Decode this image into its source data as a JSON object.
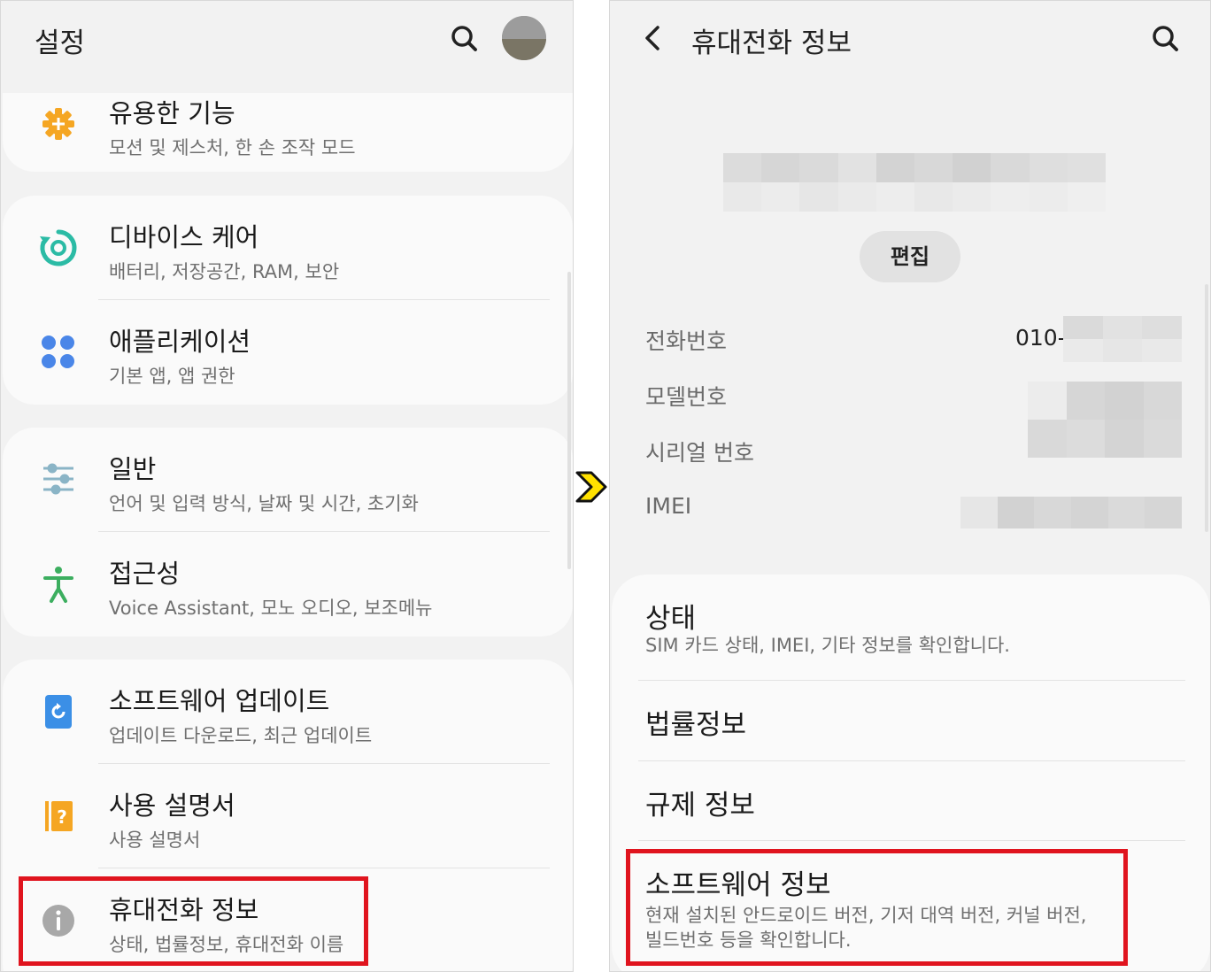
{
  "settings": {
    "title": "설정",
    "search_icon": "search-icon",
    "avatar_icon": "avatar",
    "items": [
      {
        "label": "유용한 기능",
        "sub": "모션 및 제스처, 한 손 조작 모드",
        "icon": "advanced-features-icon",
        "color": "#f5a623"
      },
      {
        "label": "디바이스 케어",
        "sub": "배터리, 저장공간, RAM, 보안",
        "icon": "device-care-icon",
        "color": "#2bbba5"
      },
      {
        "label": "애플리케이션",
        "sub": "기본 앱, 앱 권한",
        "icon": "apps-icon",
        "color": "#4a86e8"
      },
      {
        "label": "일반",
        "sub": "언어 및 입력 방식, 날짜 및 시간, 초기화",
        "icon": "general-management-icon",
        "color": "#8ab4c6"
      },
      {
        "label": "접근성",
        "sub": "Voice Assistant, 모노 오디오, 보조메뉴",
        "icon": "accessibility-icon",
        "color": "#3cae5f"
      },
      {
        "label": "소프트웨어 업데이트",
        "sub": "업데이트 다운로드, 최근 업데이트",
        "icon": "software-update-icon",
        "color": "#3b8fe6"
      },
      {
        "label": "사용 설명서",
        "sub": "사용 설명서",
        "icon": "user-manual-icon",
        "color": "#f5a623"
      },
      {
        "label": "휴대전화 정보",
        "sub": "상태, 법률정보, 휴대전화 이름",
        "icon": "info-icon",
        "color": "#a8a8a8"
      }
    ]
  },
  "about": {
    "title": "휴대전화 정보",
    "edit_label": "편집",
    "phone_label": "전화번호",
    "phone_value": "010-",
    "model_label": "모델번호",
    "serial_label": "시리얼 번호",
    "imei_label": "IMEI",
    "items": [
      {
        "label": "상태",
        "sub": "SIM 카드 상태, IMEI, 기타 정보를 확인합니다."
      },
      {
        "label": "법률정보",
        "sub": ""
      },
      {
        "label": "규제 정보",
        "sub": ""
      },
      {
        "label": "소프트웨어 정보",
        "sub": "현재 설치된 안드로이드 버전, 기저 대역 버전, 커널 버전,",
        "sub2": "빌드번호 등을 확인합니다."
      }
    ]
  },
  "colors": {
    "highlight": "#e0141e",
    "arrow": "#ffe100"
  }
}
